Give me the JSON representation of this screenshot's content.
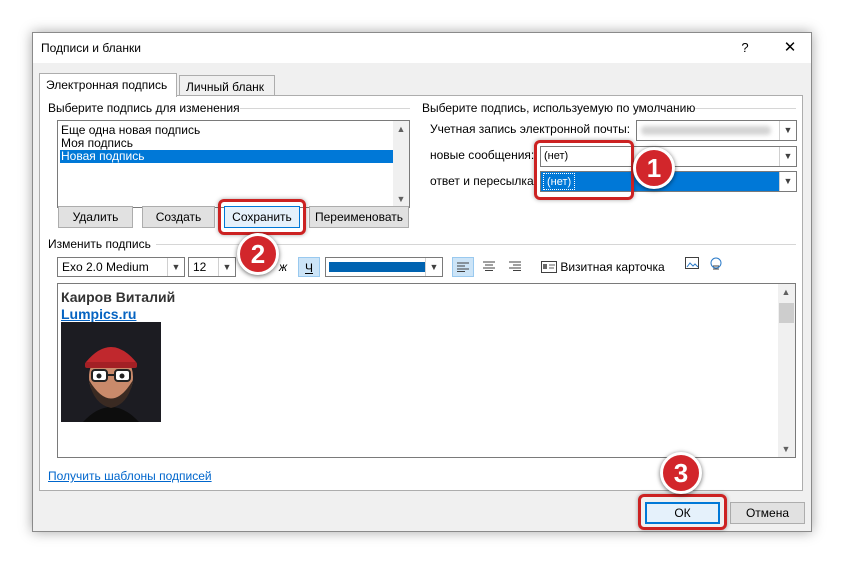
{
  "window": {
    "title": "Подписи и бланки",
    "help": "?",
    "close": "✕"
  },
  "tabs": [
    {
      "label": "Электронная подпись",
      "active": true
    },
    {
      "label": "Личный бланк",
      "active": false
    }
  ],
  "select_signature": {
    "group_label": "Выберите подпись для изменения",
    "items": [
      {
        "label": "Еще одна новая подпись",
        "selected": false
      },
      {
        "label": "Моя подпись",
        "selected": false
      },
      {
        "label": "Новая подпись",
        "selected": true
      }
    ],
    "buttons": {
      "delete": "Удалить",
      "create": "Создать",
      "save": "Сохранить",
      "rename": "Переименовать"
    }
  },
  "default_signature": {
    "group_label": "Выберите подпись, используемую по умолчанию",
    "account_label": "Учетная запись электронной почты:",
    "new_messages_label": "новые сообщения:",
    "new_messages_value": "(нет)",
    "replies_label": "ответ и пересылка:",
    "replies_value": "(нет)"
  },
  "edit_signature": {
    "group_label": "Изменить подпись",
    "font": "Exo 2.0 Medium",
    "size": "12",
    "underline_label": "Ч",
    "font_color": "#0063b1",
    "business_card": "Визитная карточка",
    "content": {
      "name": "Каиров Виталий",
      "link": "Lumpics.ru"
    }
  },
  "templates_link": "Получить шаблоны подписей",
  "footer": {
    "ok": "ОК",
    "cancel": "Отмена"
  },
  "markers": [
    "1",
    "2",
    "3"
  ],
  "colors": {
    "accent": "#0078d7",
    "highlight": "#cc2222",
    "marker": "#d2262b",
    "link": "#0563c1"
  }
}
